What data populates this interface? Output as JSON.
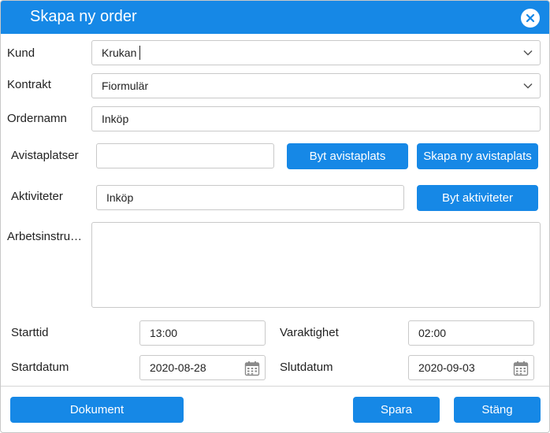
{
  "dialog": {
    "title": "Skapa ny order"
  },
  "form": {
    "kund": {
      "label": "Kund",
      "value": "Krukan"
    },
    "kontrakt": {
      "label": "Kontrakt",
      "value": "Fiormulär"
    },
    "ordernamn": {
      "label": "Ordernamn",
      "value": "Inköp"
    },
    "avistaplatser": {
      "label": "Avistaplatser",
      "value": ""
    },
    "aktiviteter": {
      "label": "Aktiviteter",
      "value": "Inköp"
    },
    "arbetsinstruktion": {
      "label": "Arbetsinstru…",
      "value": ""
    },
    "starttid": {
      "label": "Starttid",
      "value": "13:00"
    },
    "varaktighet": {
      "label": "Varaktighet",
      "value": "02:00"
    },
    "startdatum": {
      "label": "Startdatum",
      "value": "2020-08-28"
    },
    "slutdatum": {
      "label": "Slutdatum",
      "value": "2020-09-03"
    }
  },
  "buttons": {
    "byt_avistaplats": "Byt avistaplats",
    "skapa_ny_avistaplats": "Skapa ny avistaplats",
    "byt_aktiviteter": "Byt aktiviteter",
    "dokument": "Dokument",
    "spara": "Spara",
    "stang": "Stäng"
  },
  "colors": {
    "accent": "#1688e6",
    "border": "#c9c9c9"
  },
  "icons": {
    "close": "close-icon",
    "dropdown": "chevron-down-icon",
    "calendar": "calendar-icon"
  }
}
